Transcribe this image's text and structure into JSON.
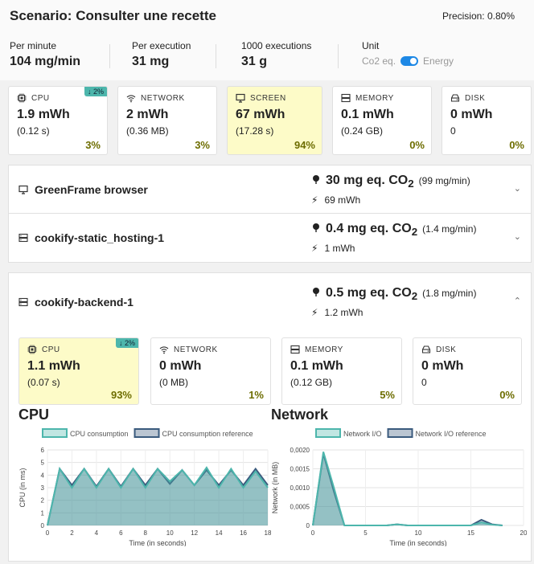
{
  "header": {
    "title": "Scenario: Consulter une recette",
    "precision": "Precision: 0.80%"
  },
  "stats": {
    "per_minute_label": "Per minute",
    "per_minute_value": "104 mg/min",
    "per_execution_label": "Per execution",
    "per_execution_value": "31 mg",
    "executions_label": "1000 executions",
    "executions_value": "31 g",
    "unit_label": "Unit",
    "unit_left": "Co2 eq.",
    "unit_right": "Energy"
  },
  "summary_cards": [
    {
      "label": "CPU",
      "icon": "cpu-icon",
      "value": "1.9 mWh",
      "sub": "(0.12 s)",
      "pct": "3%",
      "badge": "↓ 2%"
    },
    {
      "label": "NETWORK",
      "icon": "wifi-icon",
      "value": "2 mWh",
      "sub": "(0.36 MB)",
      "pct": "3%"
    },
    {
      "label": "SCREEN",
      "icon": "monitor-icon",
      "value": "67 mWh",
      "sub": "(17.28 s)",
      "pct": "94%"
    },
    {
      "label": "MEMORY",
      "icon": "memory-icon",
      "value": "0.1 mWh",
      "sub": "(0.24 GB)",
      "pct": "0%"
    },
    {
      "label": "DISK",
      "icon": "disk-icon",
      "value": "0 mWh",
      "sub": "0",
      "pct": "0%"
    }
  ],
  "containers": [
    {
      "name": "GreenFrame browser",
      "icon": "monitor-icon",
      "co2": "30 mg eq. CO",
      "co2_sub": "2",
      "rate": "(99 mg/min)",
      "energy": "69 mWh",
      "chevron": "⌄"
    },
    {
      "name": "cookify-static_hosting-1",
      "icon": "server-icon",
      "co2": "0.4 mg eq. CO",
      "co2_sub": "2",
      "rate": "(1.4 mg/min)",
      "energy": "1 mWh",
      "chevron": "⌄"
    },
    {
      "name": "cookify-backend-1",
      "icon": "server-icon",
      "co2": "0.5 mg eq. CO",
      "co2_sub": "2",
      "rate": "(1.8 mg/min)",
      "energy": "1.2 mWh",
      "chevron": "⌃"
    }
  ],
  "backend_cards": [
    {
      "label": "CPU",
      "icon": "cpu-icon",
      "value": "1.1 mWh",
      "sub": "(0.07 s)",
      "pct": "93%",
      "badge": "↓ 2%"
    },
    {
      "label": "NETWORK",
      "icon": "wifi-icon",
      "value": "0 mWh",
      "sub": "(0 MB)",
      "pct": "1%"
    },
    {
      "label": "MEMORY",
      "icon": "memory-icon",
      "value": "0.1 mWh",
      "sub": "(0.12 GB)",
      "pct": "5%"
    },
    {
      "label": "DISK",
      "icon": "disk-icon",
      "value": "0 mWh",
      "sub": "0",
      "pct": "0%"
    }
  ],
  "colors": {
    "teal": "#4db6ac",
    "navy": "#3b5b7e",
    "highlight": "#fdfbc8",
    "accent": "#1e88e5"
  },
  "chart_data": [
    {
      "type": "area",
      "title": "CPU",
      "xlabel": "Time (in seconds)",
      "ylabel": "CPU (in ms)",
      "xlim": [
        0,
        18
      ],
      "ylim": [
        0,
        6
      ],
      "xticks": [
        "0",
        "2",
        "4",
        "6",
        "8",
        "10",
        "12",
        "14",
        "16",
        "18"
      ],
      "yticks": [
        "0",
        "1",
        "2",
        "3",
        "4",
        "5",
        "6"
      ],
      "x": [
        0,
        1,
        2,
        3,
        4,
        5,
        6,
        7,
        8,
        9,
        10,
        11,
        12,
        13,
        14,
        15,
        16,
        17,
        18
      ],
      "series": [
        {
          "name": "CPU consumption",
          "color": "#4db6ac",
          "values": [
            0,
            4.5,
            3,
            4.5,
            3,
            4.5,
            3,
            4.5,
            3,
            4.5,
            3.5,
            4.4,
            3.2,
            4.6,
            3,
            4.5,
            3,
            4.3,
            3
          ]
        },
        {
          "name": "CPU consumption reference",
          "color": "#3b5b7e",
          "values": [
            0,
            4.5,
            3.2,
            4.5,
            3.1,
            4.5,
            3.1,
            4.5,
            3.2,
            4.5,
            3.3,
            4.4,
            3.2,
            4.4,
            3.2,
            4.4,
            3.2,
            4.5,
            3.2
          ]
        }
      ]
    },
    {
      "type": "area",
      "title": "Network",
      "xlabel": "Time (in seconds)",
      "ylabel": "Network (in MB)",
      "xlim": [
        0,
        20
      ],
      "ylim": [
        0,
        0.002
      ],
      "xticks": [
        "0",
        "5",
        "10",
        "15",
        "20"
      ],
      "yticks": [
        "0",
        "0,0005",
        "0,0010",
        "0,0015",
        "0,0020"
      ],
      "x": [
        0,
        1,
        2,
        3,
        4,
        5,
        6,
        7,
        8,
        9,
        10,
        11,
        12,
        13,
        14,
        15,
        16,
        17,
        18
      ],
      "series": [
        {
          "name": "Network I/O",
          "color": "#4db6ac",
          "values": [
            0,
            0.00195,
            0.001,
            0,
            0,
            0,
            0,
            0,
            3e-05,
            0,
            0,
            0,
            0,
            0,
            0,
            0,
            8e-05,
            2e-05,
            0
          ]
        },
        {
          "name": "Network I/O reference",
          "color": "#3b5b7e",
          "values": [
            0,
            0.0019,
            0.0009,
            0,
            0,
            0,
            0,
            0,
            3e-05,
            0,
            0,
            0,
            0,
            0,
            0,
            0,
            0.00015,
            3e-05,
            0
          ]
        }
      ]
    }
  ]
}
